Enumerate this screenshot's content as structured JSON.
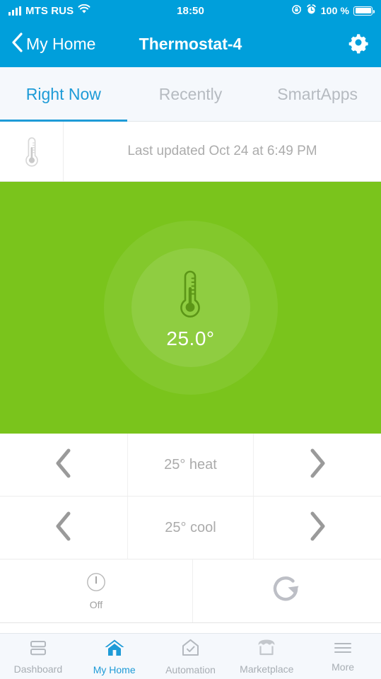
{
  "status_bar": {
    "carrier": "MTS RUS",
    "time": "18:50",
    "battery_percent": "100 %",
    "icons": [
      "signal-bars-icon",
      "wifi-icon",
      "rotation-lock-icon",
      "alarm-clock-icon",
      "battery-icon"
    ]
  },
  "nav": {
    "back_label": "My Home",
    "title": "Thermostat-4",
    "back_icon": "chevron-left-icon",
    "settings_icon": "gear-icon"
  },
  "tabs": [
    {
      "label": "Right Now",
      "active": true
    },
    {
      "label": "Recently",
      "active": false
    },
    {
      "label": "SmartApps",
      "active": false
    }
  ],
  "status_row": {
    "icon": "thermometer-icon",
    "text": "Last updated Oct 24 at 6:49 PM"
  },
  "hero": {
    "temperature": "25.0°",
    "icon": "thermometer-icon",
    "background_color": "#7AC41C"
  },
  "setpoints": [
    {
      "label": "25° heat",
      "decrease_icon": "chevron-left-icon",
      "increase_icon": "chevron-right-icon"
    },
    {
      "label": "25° cool",
      "decrease_icon": "chevron-left-icon",
      "increase_icon": "chevron-right-icon"
    }
  ],
  "mode_row": {
    "power_label": "Off",
    "power_icon": "power-icon",
    "fan_icon": "refresh-icon"
  },
  "tabbar": [
    {
      "label": "Dashboard",
      "icon": "dashboard-icon",
      "active": false
    },
    {
      "label": "My Home",
      "icon": "home-icon",
      "active": true
    },
    {
      "label": "Automation",
      "icon": "automation-check-icon",
      "active": false
    },
    {
      "label": "Marketplace",
      "icon": "storefront-icon",
      "active": false
    },
    {
      "label": "More",
      "icon": "hamburger-icon",
      "active": false
    }
  ],
  "colors": {
    "brand_blue": "#009FDB",
    "accent_blue": "#1E9BD7",
    "hero_green": "#7AC41C",
    "muted_gray": "#ABABAB"
  }
}
